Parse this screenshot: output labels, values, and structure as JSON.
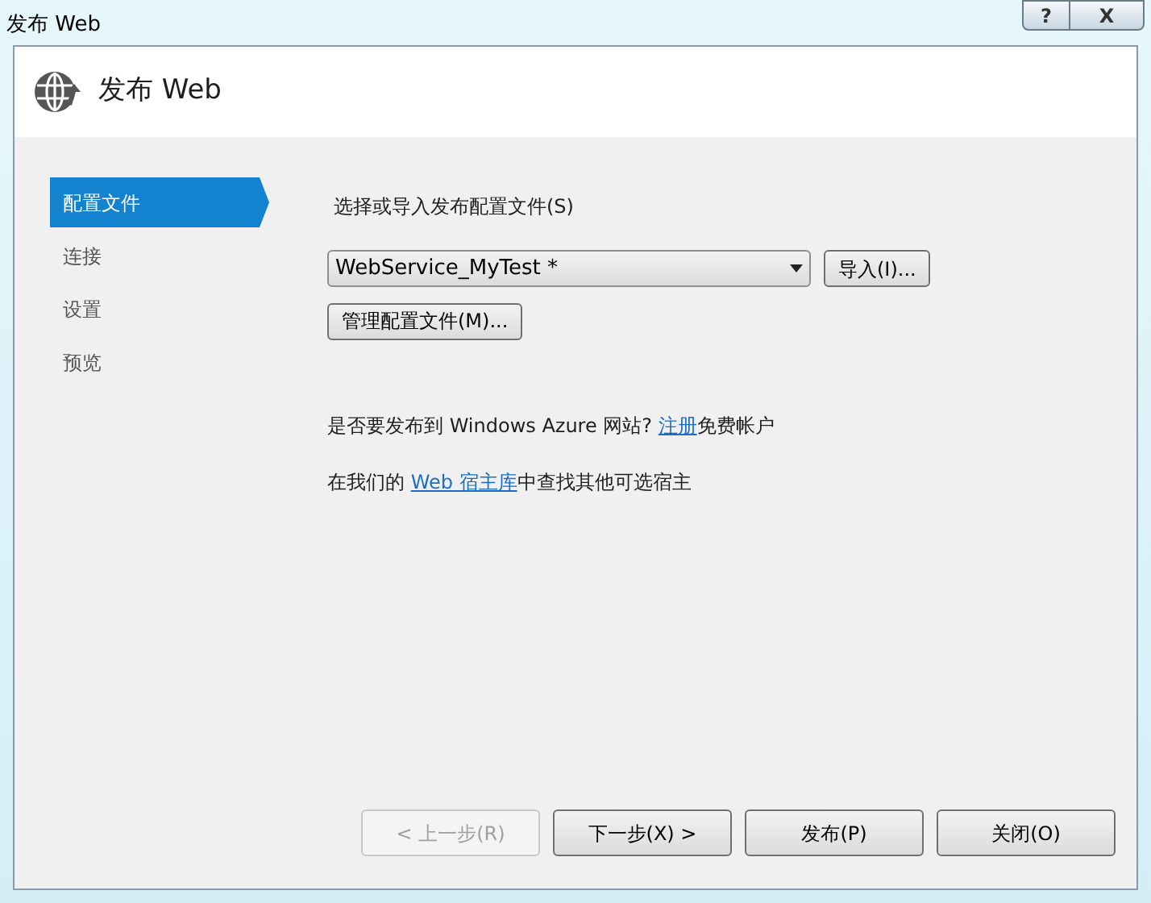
{
  "window": {
    "title": "发布 Web",
    "controls": [
      "?",
      "X"
    ]
  },
  "header": {
    "title": "发布 Web"
  },
  "sidebar": {
    "items": [
      {
        "label": "配置文件",
        "selected": true
      },
      {
        "label": "连接",
        "selected": false
      },
      {
        "label": "设置",
        "selected": false
      },
      {
        "label": "预览",
        "selected": false
      }
    ]
  },
  "profile": {
    "label": "选择或导入发布配置文件(S)",
    "dropdown_value": "WebService_MyTest *",
    "import_button": "导入(I)...",
    "manage_button": "管理配置文件(M)..."
  },
  "links": [
    {
      "before": "是否要发布到 Windows Azure 网站? ",
      "link": "注册",
      "after": "免费帐户"
    },
    {
      "before": "在我们的 ",
      "link": "Web 宿主库",
      "after": "中查找其他可选宿主"
    }
  ],
  "buttons": [
    {
      "label": "< 上一步(R)",
      "disabled": true
    },
    {
      "label": "下一步(X) >",
      "disabled": false
    },
    {
      "label": "发布(P)",
      "disabled": false
    },
    {
      "label": "关闭(O)",
      "disabled": false
    }
  ]
}
